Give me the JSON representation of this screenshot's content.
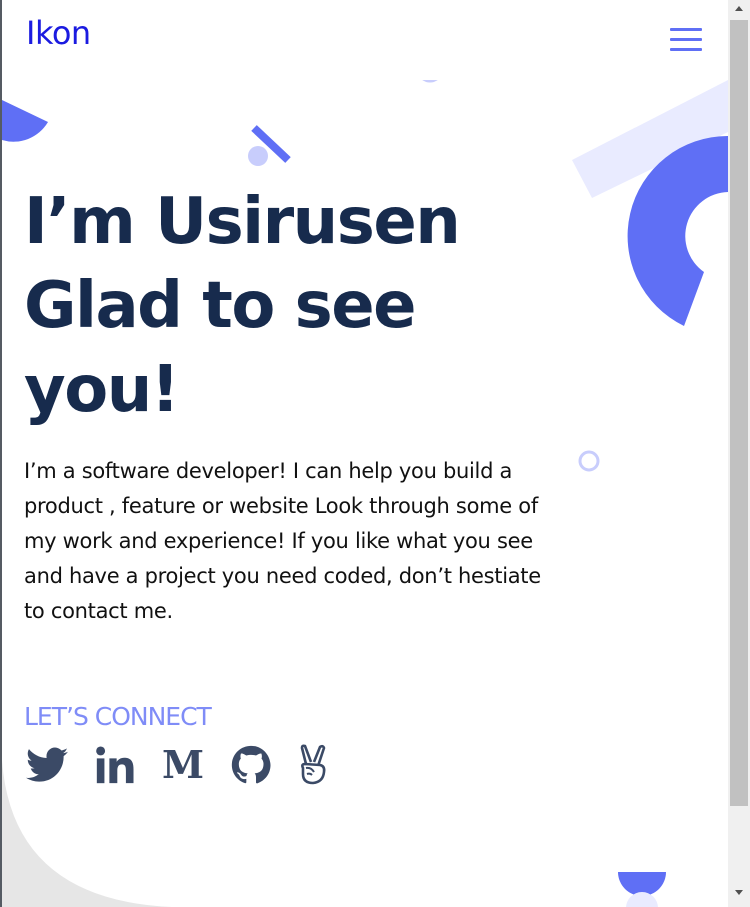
{
  "header": {
    "logo": "Ikon"
  },
  "icons": {
    "menu": "hamburger-menu-icon",
    "socials": [
      "twitter-icon",
      "linkedin-icon",
      "medium-icon",
      "github-icon",
      "angellist-icon"
    ]
  },
  "hero": {
    "title_line1": "I’m Usirusen",
    "title_line2": "Glad to see",
    "title_line3": "you!",
    "description": "I’m a software developer! I can help you build a product , feature or website Look through some of my work and experience! If you like what you see and have a project you need coded, don’t hestiate to contact me."
  },
  "connect": {
    "label": "LET’S CONNECT"
  },
  "colors": {
    "logo": "#1b1be0",
    "title": "#172b4d",
    "accent": "#5f6ff5",
    "connect": "#7f8cf7",
    "icon": "#3b4a66"
  }
}
